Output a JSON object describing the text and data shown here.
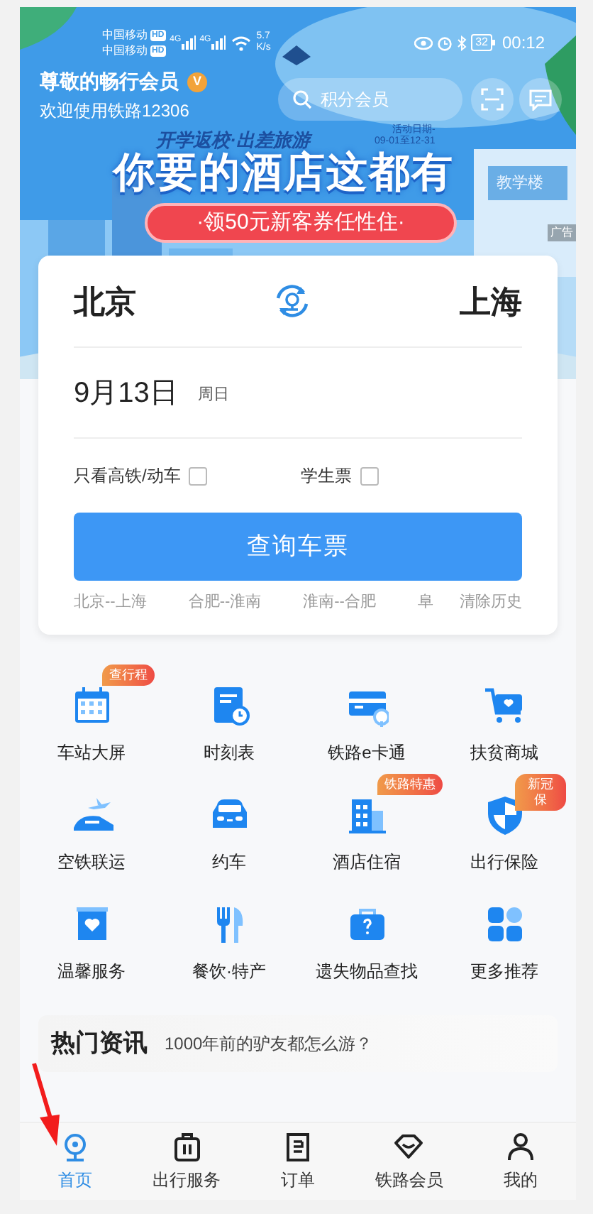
{
  "status_bar": {
    "carriers": [
      {
        "name": "中国移动",
        "badge": "HD"
      },
      {
        "name": "中国移动",
        "badge": "HD"
      }
    ],
    "networks": [
      "4G",
      "4G"
    ],
    "speed": [
      "5.7",
      "K/s"
    ],
    "battery": "32",
    "time": "00:12"
  },
  "header": {
    "member_name": "尊敬的畅行会员",
    "member_badge": "V",
    "welcome": "欢迎使用铁路12306",
    "search_placeholder": "积分会员"
  },
  "banner": {
    "subtitle": "开学返校·出差旅游",
    "dates": [
      "活动日期-",
      "09-01至12-31"
    ],
    "headline": "你要的酒店这都有",
    "coupon": "·领50元新客券任性住·",
    "sign": "教学楼",
    "ad_tag": "广告"
  },
  "search_card": {
    "from": "北京",
    "to": "上海",
    "date": "9月13日",
    "weekday": "周日",
    "options": [
      {
        "label": "只看高铁/动车",
        "checked": false
      },
      {
        "label": "学生票",
        "checked": false
      }
    ],
    "button": "查询车票",
    "history": [
      "北京--上海",
      "合肥--淮南",
      "淮南--合肥",
      "阜"
    ],
    "clear": "清除历史"
  },
  "services": [
    {
      "kind": "calendar",
      "label": "车站大屏",
      "badge": "查行程"
    },
    {
      "kind": "timetable",
      "label": "时刻表"
    },
    {
      "kind": "card",
      "label": "铁路e卡通"
    },
    {
      "kind": "cart",
      "label": "扶贫商城"
    },
    {
      "kind": "plane",
      "label": "空铁联运"
    },
    {
      "kind": "car",
      "label": "约车"
    },
    {
      "kind": "hotel",
      "label": "酒店住宿",
      "badge": "铁路特惠"
    },
    {
      "kind": "shield",
      "label": "出行保险",
      "badge": "新冠保"
    },
    {
      "kind": "gift",
      "label": "温馨服务"
    },
    {
      "kind": "food",
      "label": "餐饮·特产"
    },
    {
      "kind": "lost",
      "label": "遗失物品查找"
    },
    {
      "kind": "more",
      "label": "更多推荐"
    }
  ],
  "news": {
    "title": "热门资讯",
    "headline": "1000年前的驴友都怎么游？"
  },
  "nav": [
    {
      "kind": "home",
      "label": "首页",
      "selected": true
    },
    {
      "kind": "suitcase",
      "label": "出行服务",
      "selected": false
    },
    {
      "kind": "order",
      "label": "订单",
      "selected": false
    },
    {
      "kind": "diamond",
      "label": "铁路会员",
      "selected": false
    },
    {
      "kind": "person",
      "label": "我的",
      "selected": false
    }
  ]
}
